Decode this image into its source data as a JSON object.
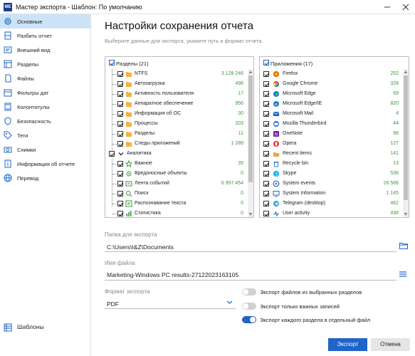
{
  "window": {
    "app_icon": "ME",
    "title": "Мастер экспорта - Шаблон: По умолчанию"
  },
  "sidebar": {
    "items": [
      {
        "label": "Основные",
        "icon": "gear-icon",
        "active": true
      },
      {
        "label": "Разбить отчет",
        "icon": "split-icon"
      },
      {
        "label": "Внешний вид",
        "icon": "appearance-icon"
      },
      {
        "label": "Разделы",
        "icon": "sections-icon"
      },
      {
        "label": "Файлы",
        "icon": "files-icon"
      },
      {
        "label": "Фильтры дат",
        "icon": "date-filter-icon"
      },
      {
        "label": "Колонтитулы",
        "icon": "header-footer-icon"
      },
      {
        "label": "Безопасность",
        "icon": "shield-icon"
      },
      {
        "label": "Теги",
        "icon": "tags-icon"
      },
      {
        "label": "Снимки",
        "icon": "snapshot-icon"
      },
      {
        "label": "Информация об отчете",
        "icon": "report-info-icon"
      },
      {
        "label": "Перевод",
        "icon": "globe-icon"
      }
    ],
    "templates_label": "Шаблоны"
  },
  "main": {
    "title": "Настройки сохранения отчета",
    "subtitle": "Выберите данные для экспорта, укажите путь и формат отчета."
  },
  "sections_panel": {
    "header": "Разделы (21)",
    "rows": [
      {
        "label": "NTFS",
        "value": "3 128 246",
        "icon": "folder-icon",
        "indent": 2
      },
      {
        "label": "Автозагрузка",
        "value": "496",
        "icon": "folder-icon",
        "indent": 2
      },
      {
        "label": "Активность пользователя",
        "value": "17",
        "icon": "folder-icon",
        "indent": 2
      },
      {
        "label": "Аппаратное обеспечение",
        "value": "956",
        "icon": "folder-icon",
        "indent": 2
      },
      {
        "label": "Информация об ОС",
        "value": "30",
        "icon": "folder-icon",
        "indent": 2
      },
      {
        "label": "Процессы",
        "value": "203",
        "icon": "folder-icon",
        "indent": 2
      },
      {
        "label": "Разделы",
        "value": "11",
        "icon": "folder-icon",
        "indent": 2
      },
      {
        "label": "Следы приложений",
        "value": "1 289",
        "icon": "folder-icon",
        "indent": 2
      },
      {
        "label": "Аналитика",
        "value": "",
        "icon": "chevron-down-icon",
        "indent": 1
      },
      {
        "label": "Важное",
        "value": "35",
        "icon": "star-icon",
        "indent": 2
      },
      {
        "label": "Вредоносные объекты",
        "value": "0",
        "icon": "virus-icon",
        "indent": 2
      },
      {
        "label": "Лента событий",
        "value": "6 957 454",
        "icon": "timeline-icon",
        "indent": 2
      },
      {
        "label": "Поиск",
        "value": "0",
        "icon": "search-icon",
        "indent": 2
      },
      {
        "label": "Распознавание текста",
        "value": "0",
        "icon": "ocr-icon",
        "indent": 2
      },
      {
        "label": "Статистика",
        "value": "0",
        "icon": "statistics-icon",
        "indent": 2
      }
    ]
  },
  "apps_panel": {
    "header": "Приложения (17)",
    "rows": [
      {
        "label": "Firefox",
        "value": "252",
        "icon": "firefox-icon"
      },
      {
        "label": "Google Chrome",
        "value": "328",
        "icon": "chrome-icon"
      },
      {
        "label": "Microsoft Edge",
        "value": "69",
        "icon": "edge-icon"
      },
      {
        "label": "Microsoft Edge/IE",
        "value": "820",
        "icon": "edge-ie-icon"
      },
      {
        "label": "Microsoft Mail",
        "value": "4",
        "icon": "mail-icon"
      },
      {
        "label": "Mozilla Thunderbird",
        "value": "44",
        "icon": "thunderbird-icon"
      },
      {
        "label": "OneNote",
        "value": "96",
        "icon": "onenote-icon"
      },
      {
        "label": "Opera",
        "value": "127",
        "icon": "opera-icon"
      },
      {
        "label": "Recent items",
        "value": "141",
        "icon": "recent-items-icon"
      },
      {
        "label": "Recycle bin",
        "value": "13",
        "icon": "recycle-bin-icon"
      },
      {
        "label": "Skype",
        "value": "536",
        "icon": "skype-icon"
      },
      {
        "label": "System events",
        "value": "28 566",
        "icon": "system-events-icon"
      },
      {
        "label": "System Information",
        "value": "1 145",
        "icon": "system-info-icon"
      },
      {
        "label": "Telegram (desktop)",
        "value": "462",
        "icon": "telegram-icon"
      },
      {
        "label": "User activity",
        "value": "436",
        "icon": "user-activity-icon"
      }
    ]
  },
  "export_folder": {
    "label": "Папка для экспорта",
    "value": "C:\\Users\\I&Z\\Documents"
  },
  "file_name": {
    "label": "Имя файла",
    "value": "Marketing-Windows PC results-27122023163105"
  },
  "export_format": {
    "label": "Формат экспорта",
    "value": "PDF"
  },
  "toggles": [
    {
      "label": "Экспорт файлов из выбранных разделов",
      "on": false
    },
    {
      "label": "Экспорт только важных записей",
      "on": false
    },
    {
      "label": "Экспорт каждого раздела в отдельный файл",
      "on": true
    }
  ],
  "buttons": {
    "primary": "Экспорт",
    "cancel": "Отмена"
  },
  "colors": {
    "accent": "#1f64c8",
    "count_green": "#3a9a3a",
    "active_nav": "#cce2f6"
  }
}
